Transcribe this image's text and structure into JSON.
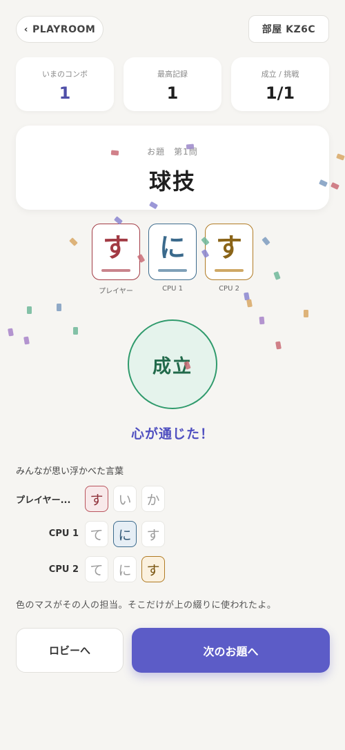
{
  "header": {
    "back_label": "PLAYROOM",
    "room_label": "部屋 KZ6C"
  },
  "stats": [
    {
      "label": "いまのコンボ",
      "value": "1"
    },
    {
      "label": "最高記録",
      "value": "1"
    },
    {
      "label": "成立 / 挑戦",
      "value": "1/1"
    }
  ],
  "topic": {
    "subtitle": "お題　第1問",
    "word": "球技"
  },
  "answer_tiles": [
    {
      "char": "す",
      "owner": "プレイヤー",
      "color": "#a23a44"
    },
    {
      "char": "に",
      "owner": "CPU 1",
      "color": "#3b6a8c"
    },
    {
      "char": "す",
      "owner": "CPU 2",
      "color": "#b07a22"
    }
  ],
  "result": {
    "status": "成立",
    "message": "心が通じた！"
  },
  "words_section": {
    "title": "みんなが思い浮かべた言葉",
    "rows": [
      {
        "name": "プレイヤー...",
        "chars": [
          "す",
          "い",
          "か"
        ],
        "highlight": 0
      },
      {
        "name": "CPU 1",
        "chars": [
          "て",
          "に",
          "す"
        ],
        "highlight": 1
      },
      {
        "name": "CPU 2",
        "chars": [
          "て",
          "に",
          "す"
        ],
        "highlight": 2
      }
    ]
  },
  "note": "色のマスがその人の担当。そこだけが上の綴りに使われたよ。",
  "buttons": {
    "lobby": "ロビーへ",
    "next": "次のお題へ"
  },
  "colors": {
    "accent": "#5c5cc7",
    "success": "#2f9a6c",
    "player": "#a23a44",
    "cpu1": "#3b6a8c",
    "cpu2": "#b07a22"
  }
}
